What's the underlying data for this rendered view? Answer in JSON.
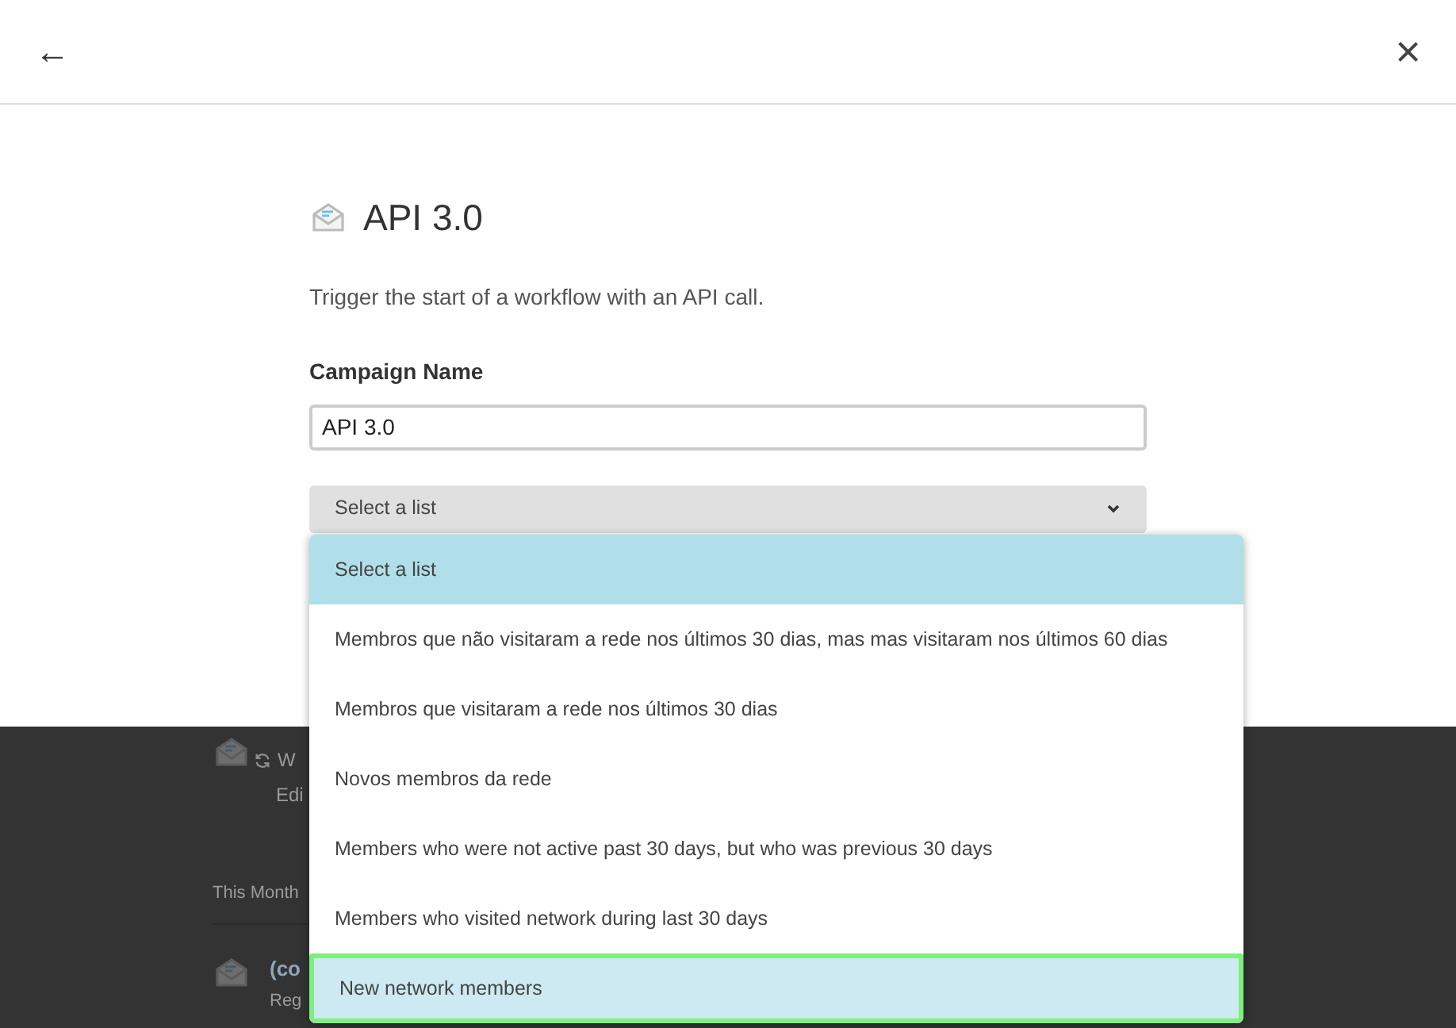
{
  "header": {
    "back": "←",
    "close": "×"
  },
  "title": "API 3.0",
  "description": "Trigger the start of a workflow with an API call.",
  "campaign_name": {
    "label": "Campaign Name",
    "value": "API 3.0"
  },
  "list_select": {
    "value": "Select a list",
    "expanded": true
  },
  "options": [
    {
      "label": "Select a list",
      "selected": true,
      "hovered": false
    },
    {
      "label": "Membros que não visitaram a rede nos últimos 30 dias, mas mas visitaram nos últimos 60 dias",
      "selected": false,
      "hovered": false
    },
    {
      "label": "Membros que visitaram a rede nos últimos 30 dias",
      "selected": false,
      "hovered": false
    },
    {
      "label": "Novos membros da rede",
      "selected": false,
      "hovered": false
    },
    {
      "label": "Members who were not active past 30 days, but who was previous 30 days",
      "selected": false,
      "hovered": false
    },
    {
      "label": "Members who visited network during last 30 days",
      "selected": false,
      "hovered": false
    },
    {
      "label": "New network members",
      "selected": false,
      "hovered": true
    }
  ],
  "background": {
    "item_1": {
      "line_1": "W",
      "line_2": "Edi"
    },
    "section": "This Month",
    "item_2": {
      "title": "(co",
      "line_1": "Reg"
    }
  }
}
